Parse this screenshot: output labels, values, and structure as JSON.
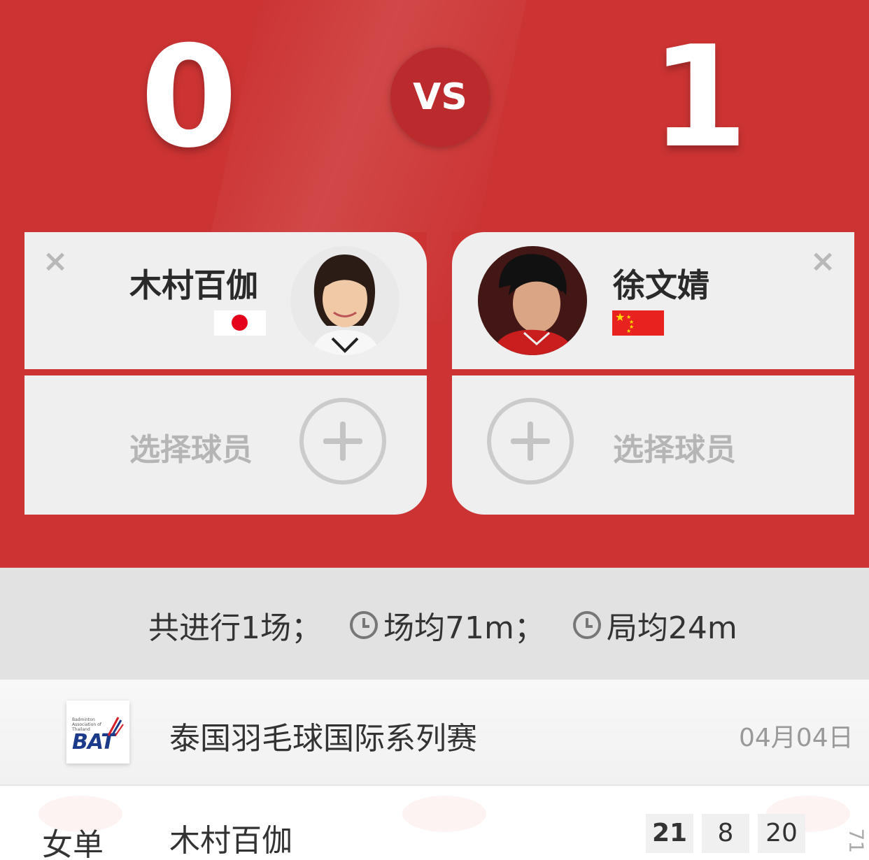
{
  "scoreboard": {
    "left_score": "0",
    "vs_label": "VS",
    "right_score": "1"
  },
  "left_player": {
    "close_icon": "×",
    "name": "木村百伽",
    "flag": "japan-flag",
    "avatar": "player-photo"
  },
  "right_player": {
    "close_icon": "×",
    "name": "徐文婧",
    "flag": "china-flag",
    "avatar": "player-photo"
  },
  "left_select": {
    "label": "选择球员"
  },
  "right_select": {
    "label": "选择球员"
  },
  "stats": {
    "total": "共进行1场；",
    "avg_match": "场均71m；",
    "avg_game": "局均24m"
  },
  "tournament": {
    "logo_small_text": "Badminton Association of Thailand",
    "logo_text": "BAT",
    "name": "泰国羽毛球国际系列赛",
    "date": "04月04日"
  },
  "match": {
    "event": "女单",
    "player": "木村百伽",
    "games": [
      "21",
      "8",
      "20"
    ],
    "edge_text": "71"
  },
  "colors": {
    "header_red": "#cc3333",
    "card_bg": "#efefef",
    "stats_bg": "#e2e2e2"
  }
}
